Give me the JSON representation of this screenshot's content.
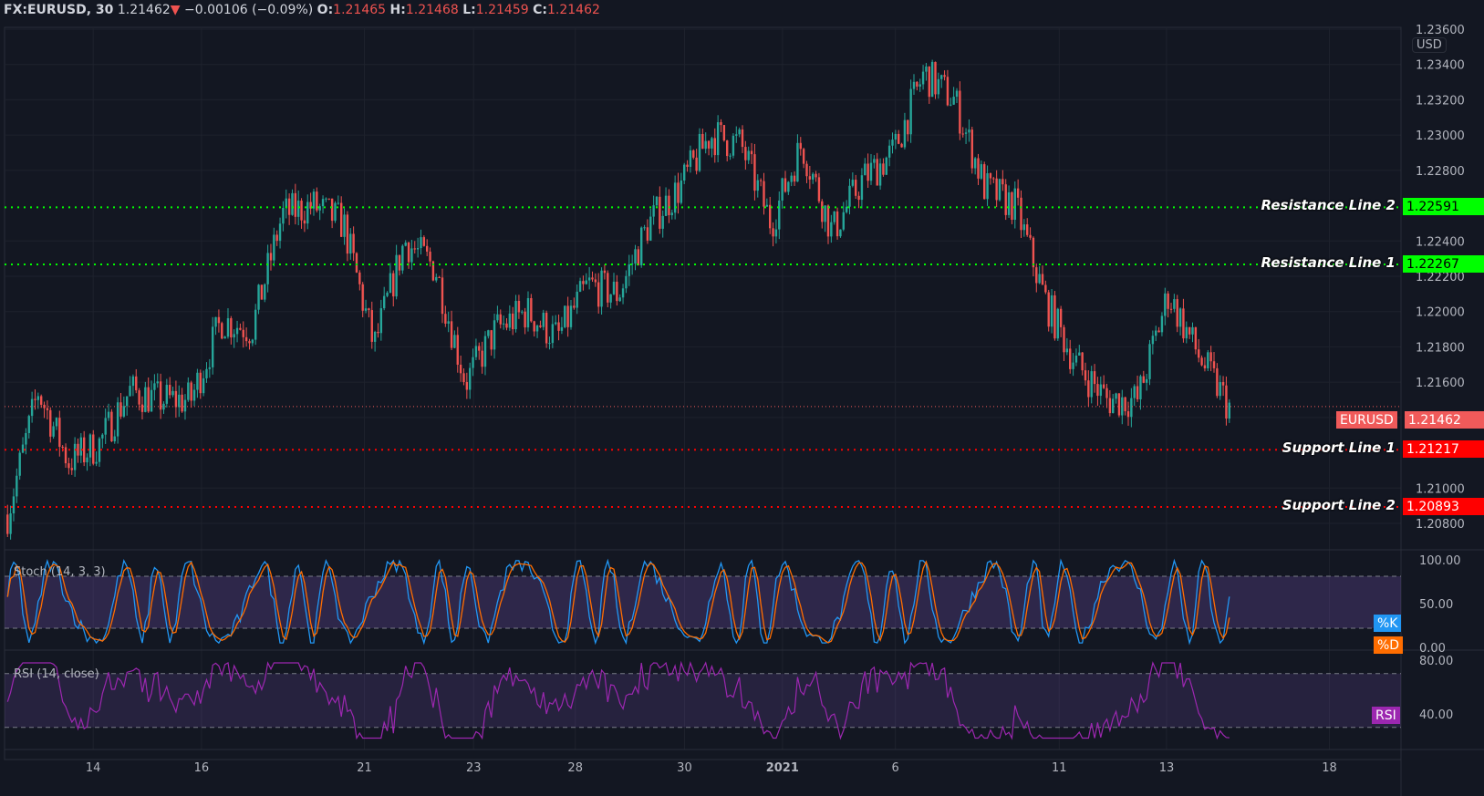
{
  "header": {
    "symbol": "FX:EURUSD, 30",
    "last": "1.21462",
    "change": "−0.00106 (−0.09%)",
    "o_label": "O:",
    "o": "1.21465",
    "h_label": "H:",
    "h": "1.21468",
    "l_label": "L:",
    "l": "1.21459",
    "c_label": "C:",
    "c": "1.21462"
  },
  "colors": {
    "up": "#26a69a",
    "down": "#ef5350",
    "resistance": "#00ff00",
    "support": "#ff0000",
    "stoch_k": "#2196f3",
    "stoch_d": "#ff6d00",
    "rsi": "#9c27b0",
    "background": "#131722"
  },
  "currency": "USD",
  "lines": [
    {
      "label": "Resistance Line 2",
      "value": "1.22591",
      "kind": "resistance"
    },
    {
      "label": "Resistance Line 1",
      "value": "1.22267",
      "kind": "resistance"
    },
    {
      "label": "Support Line 1",
      "value": "1.21217",
      "kind": "support"
    },
    {
      "label": "Support Line 2",
      "value": "1.20893",
      "kind": "support"
    }
  ],
  "last_price": {
    "label": "EURUSD",
    "value": "1.21462"
  },
  "indicators": {
    "stoch": {
      "title": "Stoch (14, 3, 3)",
      "k": "%K",
      "d": "%D",
      "ticks": [
        "100.00",
        "50.00",
        "0.00"
      ],
      "bands": [
        80,
        20
      ]
    },
    "rsi": {
      "title": "RSI (14, close)",
      "tag": "RSI",
      "ticks": [
        "80.00",
        "40.00"
      ],
      "bands": [
        70,
        30
      ]
    }
  },
  "chart_data": {
    "type": "candlestick",
    "ylim": [
      1.208,
      1.236
    ],
    "yticks": [
      "1.23600",
      "1.23400",
      "1.23200",
      "1.23000",
      "1.22800",
      "1.22400",
      "1.22200",
      "1.22000",
      "1.21800",
      "1.21600",
      "1.21400",
      "1.21000",
      "1.20800"
    ],
    "xticks": [
      "14",
      "16",
      "21",
      "23",
      "28",
      "30",
      "2021",
      "6",
      "11",
      "13",
      "18"
    ],
    "close_path": [
      1.2085,
      1.2155,
      1.2115,
      1.2125,
      1.2155,
      1.215,
      1.215,
      1.2195,
      1.219,
      1.2255,
      1.226,
      1.225,
      1.218,
      1.224,
      1.2225,
      1.216,
      1.219,
      1.22,
      1.2185,
      1.2215,
      1.221,
      1.225,
      1.227,
      1.23,
      1.2295,
      1.225,
      1.2295,
      1.2245,
      1.2275,
      1.229,
      1.2335,
      1.232,
      1.227,
      1.226,
      1.2205,
      1.217,
      1.215,
      1.215,
      1.221,
      1.2175,
      1.2146
    ]
  }
}
